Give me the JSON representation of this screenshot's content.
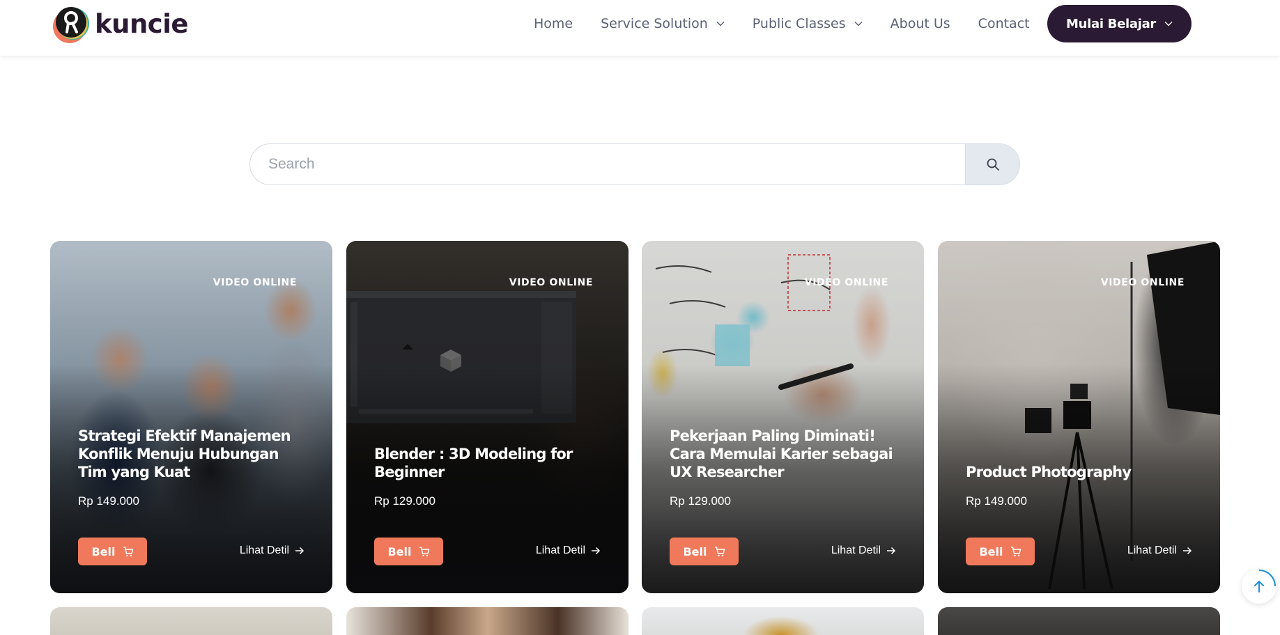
{
  "brand": {
    "name": "kuncie",
    "logo_icon": "kuncie-logo-icon"
  },
  "nav": {
    "home": "Home",
    "service": "Service Solution",
    "public": "Public Classes",
    "about": "About Us",
    "contact": "Contact",
    "cta": "Mulai Belajar"
  },
  "search": {
    "placeholder": "Search",
    "icon": "search-icon"
  },
  "cards": [
    {
      "badge": "VIDEO ONLINE",
      "title": "Strategi Efektif Manajemen Konflik Menuju Hubungan Tim yang Kuat",
      "price": "Rp 149.000",
      "buy": "Beli",
      "detail": "Lihat Detil"
    },
    {
      "badge": "VIDEO ONLINE",
      "title": "Blender : 3D Modeling for Beginner",
      "price": "Rp 129.000",
      "buy": "Beli",
      "detail": "Lihat Detil"
    },
    {
      "badge": "VIDEO ONLINE",
      "title": "Pekerjaan Paling Diminati! Cara Memulai Karier sebagai UX Researcher",
      "price": "Rp 129.000",
      "buy": "Beli",
      "detail": "Lihat Detil"
    },
    {
      "badge": "VIDEO ONLINE",
      "title": "Product Photography",
      "price": "Rp 149.000",
      "buy": "Beli",
      "detail": "Lihat Detil"
    }
  ],
  "colors": {
    "brand_dark": "#2b1a33",
    "accent": "#f0795c",
    "nav_text": "#5b6275"
  }
}
